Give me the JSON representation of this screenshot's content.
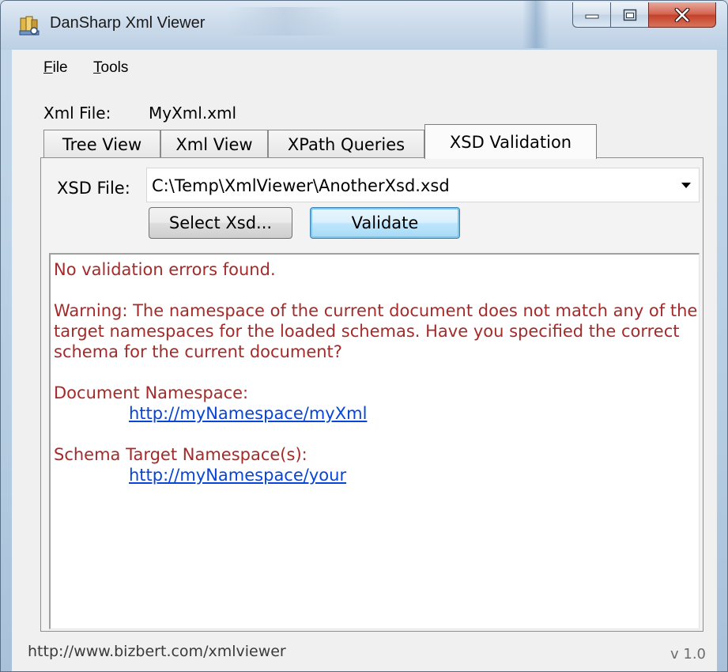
{
  "window": {
    "title": "DanSharp Xml Viewer",
    "icon": "xml-viewer-app-icon"
  },
  "menu": {
    "file": "File",
    "tools": "Tools"
  },
  "xml_file": {
    "label": "Xml File:",
    "value": "MyXml.xml"
  },
  "tabs": [
    {
      "label": "Tree View",
      "active": false
    },
    {
      "label": "Xml View",
      "active": false
    },
    {
      "label": "XPath Queries",
      "active": false
    },
    {
      "label": "XSD Validation",
      "active": true
    }
  ],
  "xsd": {
    "label": "XSD File:",
    "value": "C:\\Temp\\XmlViewer\\AnotherXsd.xsd",
    "select_button": "Select Xsd...",
    "validate_button": "Validate"
  },
  "output": {
    "line1": "No validation errors found.",
    "warning": "Warning: The namespace of the current document does not match any of the target namespaces for the loaded schemas. Have you specified the correct schema for the current document?",
    "doc_ns_label": "Document Namespace:",
    "doc_ns_link": "http://myNamespace/myXml",
    "schema_ns_label": "Schema Target Namespace(s):",
    "schema_ns_link": "http://myNamespace/your",
    "text_color": "#a52a2a",
    "link_color": "#0645d9"
  },
  "status": {
    "url": "http://www.bizbert.com/xmlviewer",
    "version": "v 1.0"
  }
}
